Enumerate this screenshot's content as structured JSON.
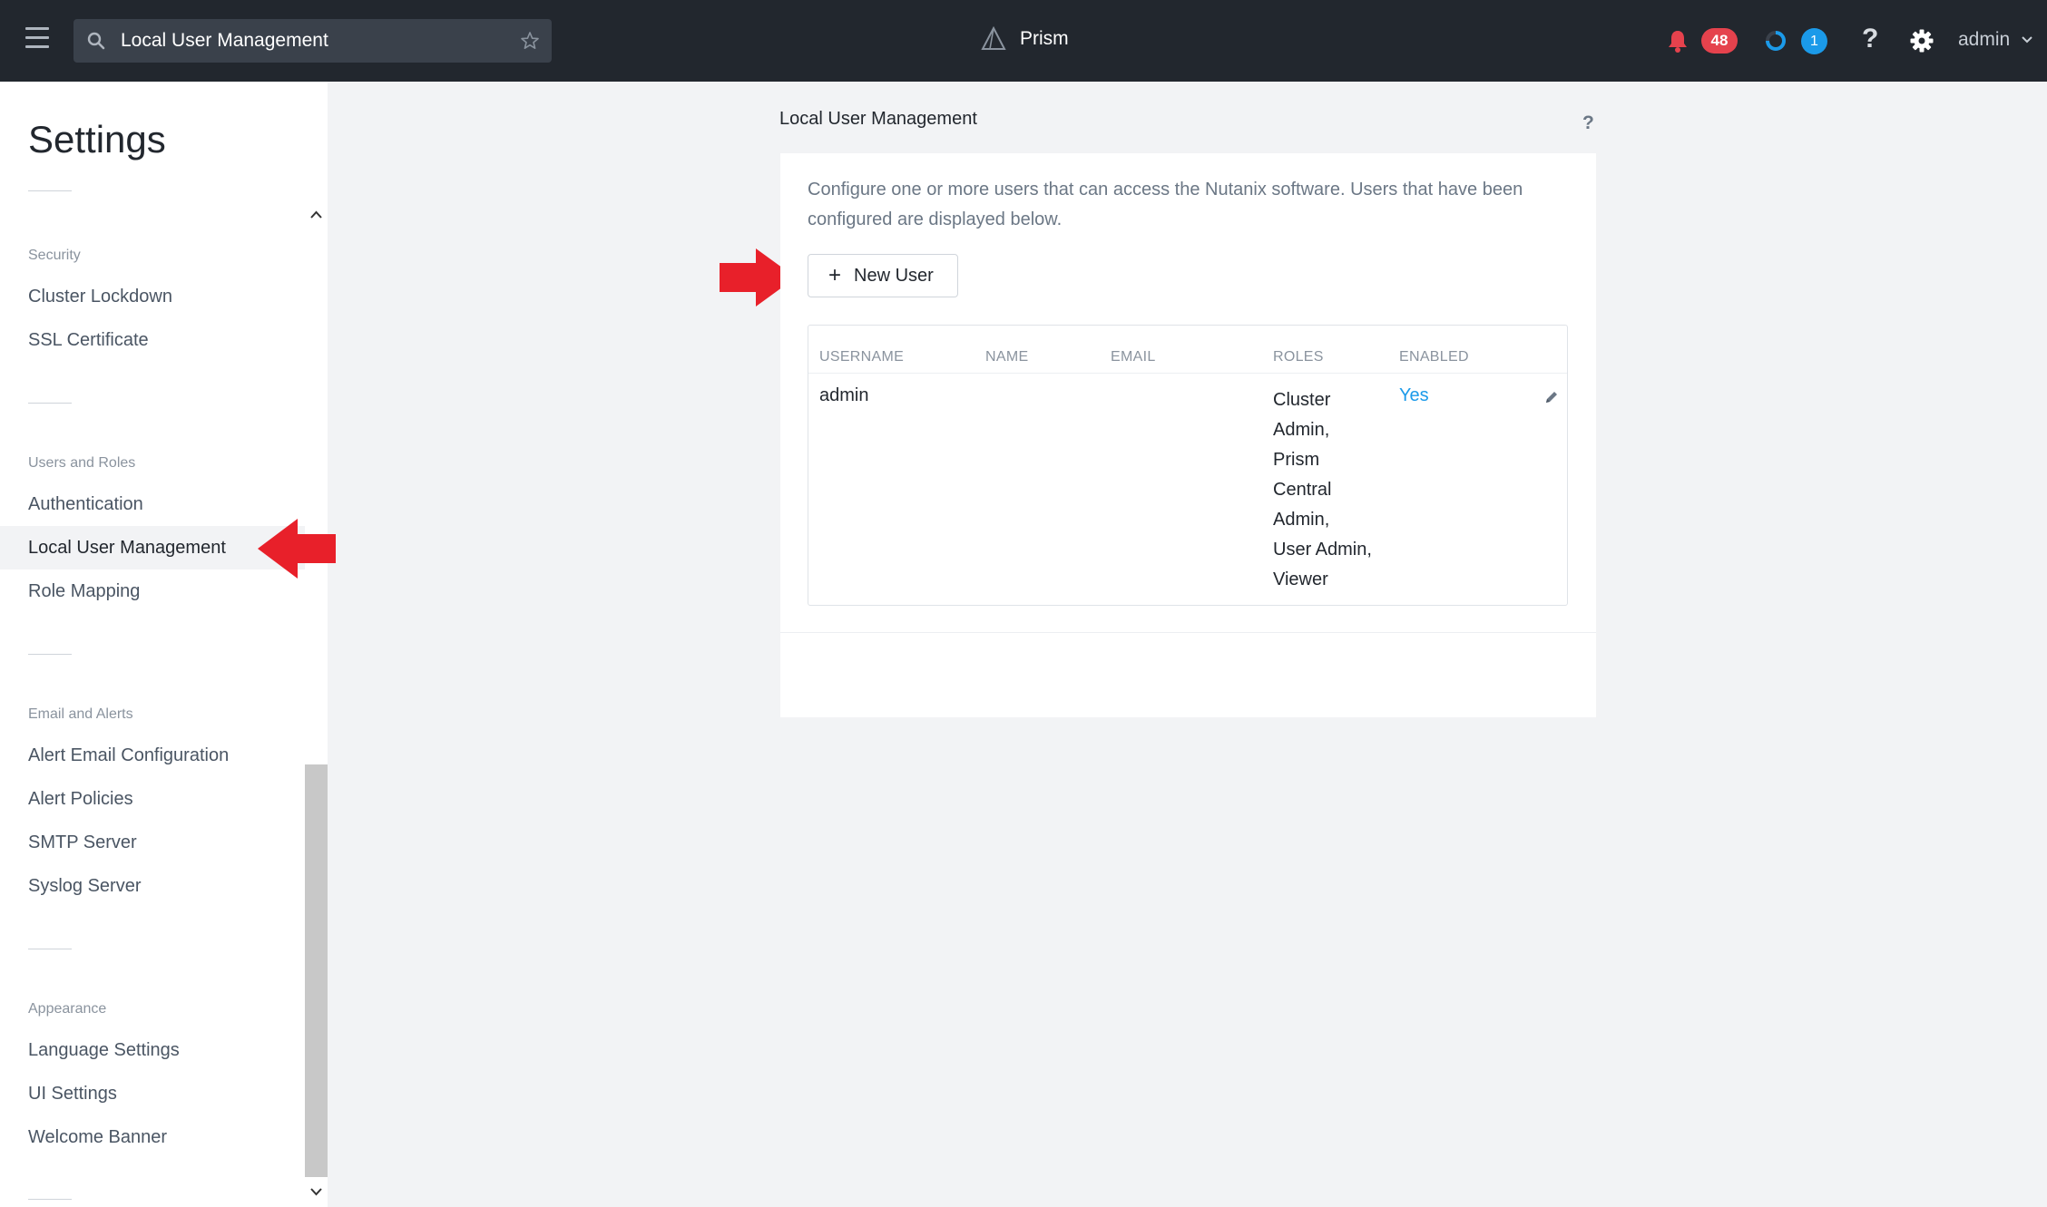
{
  "topbar": {
    "search_value": "Local User Management",
    "brand": "Prism",
    "alerts_count": "48",
    "tasks_count": "1",
    "help_label": "?",
    "user": "admin"
  },
  "sidebar": {
    "title": "Settings",
    "sections": [
      {
        "header": "Security",
        "items": [
          "Cluster Lockdown",
          "SSL Certificate"
        ]
      },
      {
        "header": "Users and Roles",
        "items": [
          "Authentication",
          "Local User Management",
          "Role Mapping"
        ]
      },
      {
        "header": "Email and Alerts",
        "items": [
          "Alert Email Configuration",
          "Alert Policies",
          "SMTP Server",
          "Syslog Server"
        ]
      },
      {
        "header": "Appearance",
        "items": [
          "Language Settings",
          "UI Settings",
          "Welcome Banner"
        ]
      }
    ],
    "active_item": "Local User Management"
  },
  "main": {
    "title": "Local User Management",
    "help_label": "?",
    "description": "Configure one or more users that can access the Nutanix software. Users that have been configured are displayed below.",
    "new_user_label": "New User",
    "new_user_symbol": "+",
    "table": {
      "headers": [
        "USERNAME",
        "NAME",
        "EMAIL",
        "ROLES",
        "ENABLED"
      ],
      "rows": [
        {
          "username": "admin",
          "name": "",
          "email": "",
          "roles_lines": [
            "Cluster",
            "Admin,",
            "Prism",
            "Central",
            "Admin,",
            "User Admin,",
            "Viewer"
          ],
          "enabled": "Yes"
        }
      ]
    }
  },
  "colors": {
    "topbar_bg": "#22272e",
    "alert_badge": "#e5424d",
    "task_badge": "#1b9ae9",
    "link_blue": "#1b9ae9",
    "annotation_red": "#e8202a"
  }
}
